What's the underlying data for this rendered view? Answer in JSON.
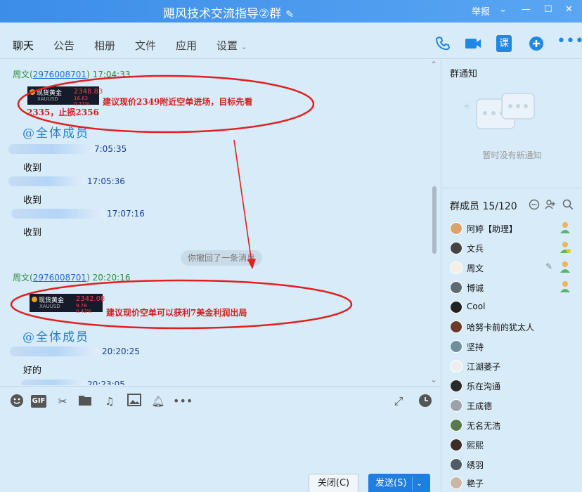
{
  "window": {
    "title": "飓风技术交流指导②群",
    "report_label": "举报",
    "controls": [
      "⌄",
      "—",
      "☐",
      "✕"
    ]
  },
  "tabs": [
    {
      "label": "聊天",
      "active": true
    },
    {
      "label": "公告"
    },
    {
      "label": "相册"
    },
    {
      "label": "文件"
    },
    {
      "label": "应用"
    },
    {
      "label": "设置"
    }
  ],
  "toolbar_icons": [
    "phone-icon",
    "video-call-icon",
    "course-icon",
    "add-icon",
    "more-icon"
  ],
  "toolbar_course_label": "课",
  "messages": {
    "m1": {
      "sender": "周文",
      "qq": "2976008701",
      "time": "17:04:33"
    },
    "gold1": {
      "name": "现货黄金",
      "symbol": "XAUUSD",
      "value": "2348.83",
      "change": "16.63",
      "pct": "0.71%"
    },
    "note1": {
      "line1": "建议现价2349附近空单进场，目标先看",
      "line2": "2335，止损2356"
    },
    "at1": "@全体成员",
    "m2": {
      "time": "7:05:35",
      "text": "收到"
    },
    "m3": {
      "time": "17:05:36",
      "text": "收到"
    },
    "m4": {
      "time": "17:07:16",
      "text": "收到"
    },
    "recall": "你撤回了一条消息",
    "m5": {
      "sender": "周文",
      "qq": "2976008701",
      "time": "20:20:16"
    },
    "gold2": {
      "name": "现货黄金",
      "symbol": "XAUUSD",
      "value": "2342.08",
      "change": "9.78",
      "pct": "0.42%"
    },
    "note2": "建议现价空单可以获利7美金利润出局",
    "at2": "@全体成员",
    "m6": {
      "time": "20:20:25",
      "text": "好的"
    },
    "m7": {
      "time": "20:23:05"
    }
  },
  "composer": {
    "icons": [
      "emoji-icon",
      "gif-icon",
      "scissors-icon",
      "folder-icon",
      "music-icon",
      "image-icon",
      "bell-icon",
      "more-icon"
    ],
    "gif_label": "GIF",
    "close_label": "关闭(C)",
    "send_label": "发送(S)"
  },
  "sidebar": {
    "notice_title": "群通知",
    "notice_empty": "暂时没有新通知",
    "members_title": "群成员 15/120",
    "members": [
      {
        "name": "阿婷【助理】",
        "role": "admin"
      },
      {
        "name": "文兵",
        "role": "owner"
      },
      {
        "name": "周文",
        "role": "admin"
      },
      {
        "name": "博诚",
        "role": "admin"
      },
      {
        "name": "Cool"
      },
      {
        "name": "哈努卡前的犹太人"
      },
      {
        "name": "坚持"
      },
      {
        "name": "江湖萎子"
      },
      {
        "name": "乐在沟通"
      },
      {
        "name": "王成德"
      },
      {
        "name": "无名无浩"
      },
      {
        "name": "熙熙"
      },
      {
        "name": "绣羽"
      },
      {
        "name": "艳子"
      }
    ]
  },
  "colors": {
    "accent": "#1e7ee2",
    "annotation": "#e02020",
    "background": "#d7ebf8"
  }
}
